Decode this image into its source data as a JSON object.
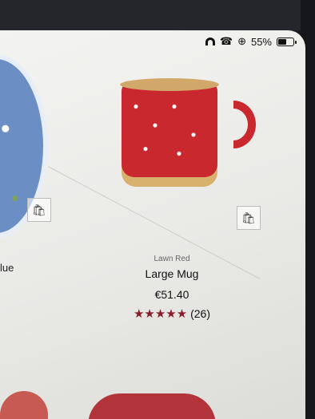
{
  "status_bar": {
    "battery": "55%"
  },
  "left_product": {
    "label_fragment": "lue",
    "price_fragment": ")"
  },
  "product": {
    "variant": "Lawn Red",
    "name": "Large Mug",
    "price": "€51.40",
    "stars": "★★★★★",
    "review_count": "(26)"
  },
  "icons": {
    "wifi": "wifi-icon",
    "phone": "phone-icon",
    "lock": "lock-rotation-icon",
    "battery": "battery-icon",
    "basket": "add-to-basket-icon"
  }
}
